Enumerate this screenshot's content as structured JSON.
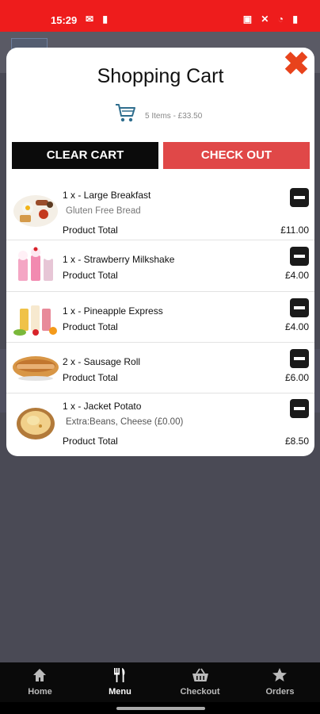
{
  "status_bar": {
    "time": "15:29"
  },
  "modal": {
    "title": "Shopping Cart",
    "cart_summary": "5 Items - £33.50",
    "clear_label": "CLEAR CART",
    "checkout_label": "CHECK OUT"
  },
  "items": [
    {
      "name": "1 x - Large Breakfast",
      "detail": "Gluten Free Bread",
      "total_label": "Product Total",
      "price": "£11.00",
      "image_icon": "breakfast-plate"
    },
    {
      "name": "1 x - Strawberry Milkshake",
      "detail": "",
      "total_label": "Product Total",
      "price": "£4.00",
      "image_icon": "milkshakes"
    },
    {
      "name": "1 x - Pineapple Express",
      "detail": "",
      "total_label": "Product Total",
      "price": "£4.00",
      "image_icon": "smoothies"
    },
    {
      "name": "2 x - Sausage Roll",
      "detail": "",
      "total_label": "Product Total",
      "price": "£6.00",
      "image_icon": "sausage-roll"
    },
    {
      "name": "1 x - Jacket Potato",
      "detail": "Extra:Beans, Cheese (£0.00)",
      "total_label": "Product Total",
      "price": "£8.50",
      "image_icon": "jacket-potato"
    }
  ],
  "tabs": [
    {
      "label": "Home",
      "icon": "home-icon"
    },
    {
      "label": "Menu",
      "icon": "cutlery-icon",
      "active": true
    },
    {
      "label": "Checkout",
      "icon": "basket-icon"
    },
    {
      "label": "Orders",
      "icon": "star-icon"
    }
  ],
  "colors": {
    "accent_red": "#ee1c1c",
    "checkout_red": "#e04848",
    "close_orange": "#e8431c"
  }
}
